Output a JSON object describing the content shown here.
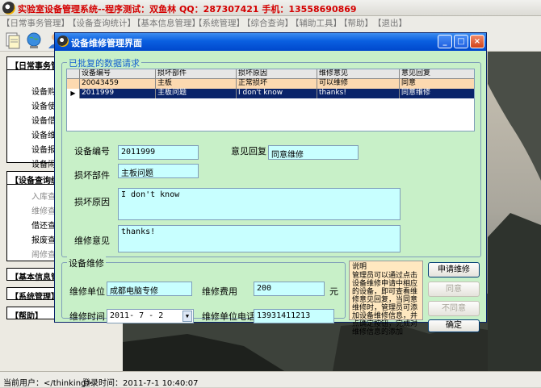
{
  "app": {
    "title": "实验室设备管理系统--程序测试：双鱼林  QQ：287307421  手机：13558690869"
  },
  "menu": [
    "【日常事务管理】",
    "【设备查询统计】",
    "【基本信息管理】",
    "【系统管理】",
    "【综合查询】",
    "【辅助工具】",
    "【帮助】",
    "【退出】"
  ],
  "leftnav": {
    "groups": [
      {
        "label": "【日常事务管",
        "items": [
          "设备购",
          "设备使",
          "设备借",
          "设备维",
          "设备报",
          "设备闹"
        ]
      },
      {
        "label": "【设备查询统",
        "items": [
          "入库查",
          "维修查",
          "借还查",
          "报废查",
          "闹修查"
        ]
      },
      {
        "label": "【基本信息管"
      },
      {
        "label": "【系统管理】"
      },
      {
        "label": "【帮助】"
      }
    ]
  },
  "status": {
    "user": "当前用户：</thinking>",
    "login": "登录时间：2011-7-1 10:40:07"
  },
  "dialog": {
    "title": "设备维修管理界面",
    "approved_legend": "已批复的数据请求",
    "grid": {
      "columns": [
        "设备编号",
        "损坏部件",
        "损坏原因",
        "维修意见",
        "意见回复"
      ],
      "rows": [
        [
          "20043459",
          "主板",
          "正常损坏",
          "可以维修",
          "同意"
        ],
        [
          "2011999",
          "主板问题",
          "I don't know",
          "thanks!",
          "同意维修"
        ]
      ]
    },
    "form": {
      "device_no_label": "设备编号",
      "device_no": "2011999",
      "reply_label": "意见回复",
      "reply": "同意维修",
      "part_label": "损坏部件",
      "part": "主板问题",
      "reason_label": "损坏原因",
      "reason": "I don't know",
      "opinion_label": "维修意见",
      "opinion": "thanks!"
    },
    "repair": {
      "legend": "设备维修",
      "unit_label": "维修单位",
      "unit": "成都电脑专修",
      "cost_label": "维修费用",
      "cost": "200",
      "cost_unit": "元",
      "time_label": "维修时间",
      "time": "2011- 7 - 2",
      "phone_label": "维修单位电话",
      "phone": "13931411213"
    },
    "note": {
      "title": "说明",
      "text": "管理员可以通过点击设备维修申请中相应的设备，即可查看维修意见回复，当同意维修时，管理员可添加设备维修信息，并点确定按钮，完成对维修信息的添加"
    },
    "buttons": {
      "apply": "申请维修",
      "agree": "同意",
      "disagree": "不同意",
      "confirm": "确定"
    }
  },
  "colors": {
    "dialog_bg": "#c8f0c8",
    "input_bg": "#c8ffff",
    "title_blue": "#0a5fe0",
    "selected_row": "#0a246a"
  }
}
